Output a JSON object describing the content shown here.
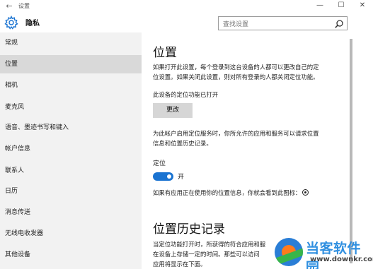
{
  "window": {
    "title": "设置",
    "back_glyph": "←",
    "minimize_glyph": "—",
    "maximize_glyph": "☐",
    "close_glyph": "✕"
  },
  "header": {
    "icon": "gear-icon",
    "title": "隐私",
    "search_placeholder": "查找设置",
    "search_icon": "search-icon"
  },
  "sidebar": {
    "items": [
      {
        "label": "常规",
        "selected": false
      },
      {
        "label": "位置",
        "selected": true
      },
      {
        "label": "相机",
        "selected": false
      },
      {
        "label": "麦克风",
        "selected": false
      },
      {
        "label": "语音、墨迹书写和键入",
        "selected": false
      },
      {
        "label": "帐户信息",
        "selected": false
      },
      {
        "label": "联系人",
        "selected": false
      },
      {
        "label": "日历",
        "selected": false
      },
      {
        "label": "消息传送",
        "selected": false
      },
      {
        "label": "无线电收发器",
        "selected": false
      },
      {
        "label": "其他设备",
        "selected": false
      }
    ]
  },
  "main": {
    "section1_title": "位置",
    "intro_line1": "如果打开此设置，每个登录到这台设备的人都可以更改自己的定",
    "intro_line2": "位设置。如果关闭此设置，则对所有登录的人都关闭定位功能。",
    "device_status": "此设备的定位功能已打开",
    "change_button": "更改",
    "account_line1": "为此帐户启用定位服务时，你所允许的应用和服务可以请求位置",
    "account_line2": "信息和位置历史记录。",
    "location_label": "定位",
    "toggle_state": "开",
    "toggle_on": true,
    "usage_note": "如果有应用正在使用你的位置信息，你就会看到此图标：",
    "usage_icon": "location-icon",
    "section2_title": "位置历史记录",
    "history_line1": "当定位功能打开时，所获得的符合应用和服",
    "history_line2": "在设备上存储一定的时间。那些可以访问",
    "history_line3": "应用将显示在下面。"
  },
  "watermark": {
    "brand": "当客软件园",
    "url": "www.downkr.com"
  },
  "colors": {
    "accent": "#1a73d1",
    "sidebar_bg": "#f2f2f2",
    "selected_bg": "#d9d9d9",
    "button_bg": "#d6d6d6"
  }
}
